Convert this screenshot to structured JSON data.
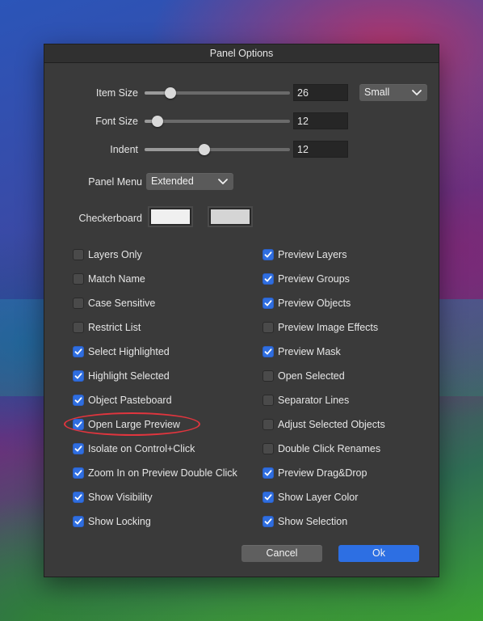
{
  "dialog": {
    "title": "Panel Options",
    "sliders": [
      {
        "label": "Item Size",
        "value": "26",
        "fraction": 0.18
      },
      {
        "label": "Font Size",
        "value": "12",
        "fraction": 0.09
      },
      {
        "label": "Indent",
        "value": "12",
        "fraction": 0.41
      }
    ],
    "item_size_select": "Small",
    "panel_menu": {
      "label": "Panel Menu",
      "value": "Extended"
    },
    "checkerboard": {
      "label": "Checkerboard",
      "color1": "#f0f0f0",
      "color2": "#d5d5d5"
    },
    "left_options": [
      {
        "label": "Layers Only",
        "checked": false
      },
      {
        "label": "Match Name",
        "checked": false
      },
      {
        "label": "Case Sensitive",
        "checked": false
      },
      {
        "label": "Restrict List",
        "checked": false
      },
      {
        "label": "Select Highlighted",
        "checked": true
      },
      {
        "label": "Highlight Selected",
        "checked": true
      },
      {
        "label": "Object Pasteboard",
        "checked": true
      },
      {
        "label": "Open Large Preview",
        "checked": true
      },
      {
        "label": "Isolate on Control+Click",
        "checked": true
      },
      {
        "label": "Zoom In on Preview Double Click",
        "checked": true
      },
      {
        "label": "Show Visibility",
        "checked": true
      },
      {
        "label": "Show Locking",
        "checked": true
      }
    ],
    "right_options": [
      {
        "label": "Preview Layers",
        "checked": true
      },
      {
        "label": "Preview Groups",
        "checked": true
      },
      {
        "label": "Preview Objects",
        "checked": true
      },
      {
        "label": "Preview Image Effects",
        "checked": false
      },
      {
        "label": "Preview Mask",
        "checked": true
      },
      {
        "label": "Open Selected",
        "checked": false
      },
      {
        "label": "Separator Lines",
        "checked": false
      },
      {
        "label": "Adjust Selected Objects",
        "checked": false
      },
      {
        "label": "Double Click Renames",
        "checked": false
      },
      {
        "label": "Preview Drag&Drop",
        "checked": true
      },
      {
        "label": "Show Layer Color",
        "checked": true
      },
      {
        "label": "Show Selection",
        "checked": true
      }
    ],
    "cancel_label": "Cancel",
    "ok_label": "Ok",
    "accent_color": "#2f6ee0",
    "highlight_color": "#e0353e"
  }
}
